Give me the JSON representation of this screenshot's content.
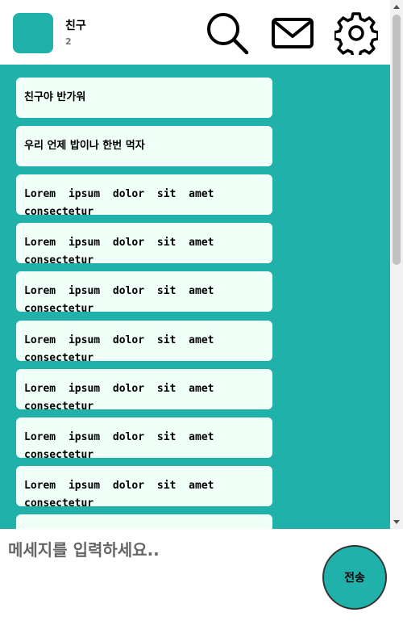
{
  "header": {
    "room_name": "친구",
    "member_count": "2",
    "icons": [
      "search-icon",
      "mail-icon",
      "gear-icon"
    ]
  },
  "messages": [
    "친구야 반가워",
    "우리 언제 밥이나 한번 먹자",
    "Lorem ipsum dolor sit amet consectetur",
    "Lorem ipsum dolor sit amet consectetur",
    "Lorem ipsum dolor sit amet consectetur",
    "Lorem ipsum dolor sit amet consectetur",
    "Lorem ipsum dolor sit amet consectetur",
    "Lorem ipsum dolor sit amet consectetur",
    "Lorem ipsum dolor sit amet consectetur",
    ""
  ],
  "composer": {
    "placeholder": "메세지를 입력하세요..",
    "send_label": "전송"
  },
  "colors": {
    "accent": "#20b2aa",
    "bubble": "#f0fff8"
  }
}
